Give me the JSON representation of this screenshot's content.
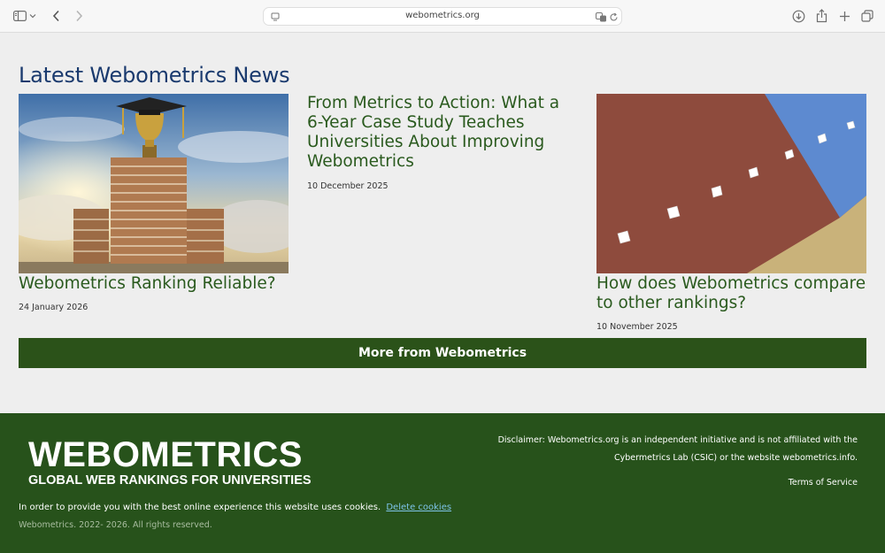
{
  "browser": {
    "url": "webometrics.org"
  },
  "main": {
    "heading": "Latest Webometrics News",
    "articles": [
      {
        "title": "Webometrics Ranking Reliable?",
        "date": "24 January 2026"
      },
      {
        "title": "From Metrics to Action: What a 6-Year Case Study Teaches Universities About Improving Webometrics",
        "date": "10 December 2025"
      },
      {
        "title": "How does Webometrics compare to other rankings?",
        "date": "10 November 2025"
      }
    ],
    "more_button": "More from Webometrics"
  },
  "footer": {
    "logo_title": "WEBOMETRICS",
    "logo_subtitle": "GLOBAL WEB RANKINGS FOR UNIVERSITIES",
    "disclaimer": "Disclaimer: Webometrics.org is an independent initiative and is not affiliated with the Cybermetrics Lab (CSIC) or the website webometrics.info.",
    "terms": "Terms of Service",
    "cookie_text": "In order to provide you with the best online experience this website uses cookies.",
    "cookie_link": "Delete cookies",
    "copyright": "Webometrics. 2022- 2026. All rights reserved."
  },
  "colors": {
    "heading": "#1a3a6e",
    "article_title": "#2a5a1e",
    "button_bg": "#2b5219",
    "footer_bg": "#27521b",
    "cookie_link": "#7ec4ea"
  }
}
